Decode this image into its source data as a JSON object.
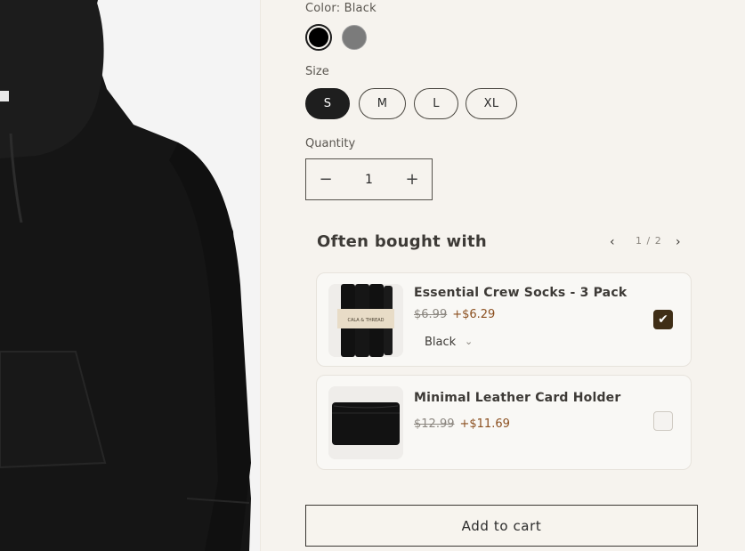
{
  "product": {
    "color_label": "Color: Black",
    "colors": [
      {
        "name": "Black",
        "hex": "#000000",
        "selected": true
      },
      {
        "name": "Grey",
        "hex": "#7b7b7b",
        "selected": false
      }
    ],
    "size_label": "Size",
    "sizes": [
      "S",
      "M",
      "L",
      "XL"
    ],
    "selected_size": "S",
    "quantity_label": "Quantity",
    "quantity": "1",
    "minus_icon": "−",
    "plus_icon": "+"
  },
  "often_bought": {
    "title": "Often bought with",
    "pager": "1 / 2",
    "prev_icon": "‹",
    "next_icon": "›",
    "items": [
      {
        "name": "Essential Crew Socks - 3 Pack",
        "old_price": "$6.99",
        "new_price": "+$6.29",
        "variant": "Black",
        "checked": true,
        "thumb_text": "CALA & THREAD"
      },
      {
        "name": "Minimal Leather Card Holder",
        "old_price": "$12.99",
        "new_price": "+$11.69",
        "checked": false
      }
    ]
  },
  "add_to_cart": "Add to cart",
  "colors": {
    "background": "#f6f3ee",
    "accent_price": "#8b4f1f",
    "checkbox_checked": "#3f2e16"
  }
}
